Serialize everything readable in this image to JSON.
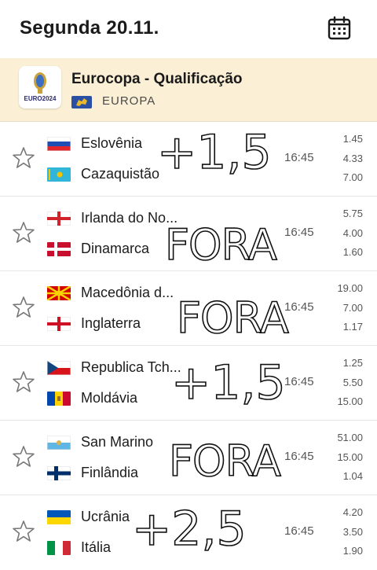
{
  "header": {
    "date": "Segunda 20.11."
  },
  "league": {
    "name": "Eurocopa - Qualificação",
    "region": "EUROPA",
    "logo_text": "EURO2024"
  },
  "matches": [
    {
      "home": "Eslovênia",
      "away": "Cazaquistão",
      "time": "16:45",
      "odds": [
        "1.45",
        "4.33",
        "7.00"
      ],
      "note": "+1,5"
    },
    {
      "home": "Irlanda do No...",
      "away": "Dinamarca",
      "time": "16:45",
      "odds": [
        "5.75",
        "4.00",
        "1.60"
      ],
      "note": "FORA"
    },
    {
      "home": "Macedônia d...",
      "away": "Inglaterra",
      "time": "16:45",
      "odds": [
        "19.00",
        "7.00",
        "1.17"
      ],
      "note": "FORA"
    },
    {
      "home": "Republica Tch...",
      "away": "Moldávia",
      "time": "16:45",
      "odds": [
        "1.25",
        "5.50",
        "15.00"
      ],
      "note": "+1,5"
    },
    {
      "home": "San Marino",
      "away": "Finlândia",
      "time": "16:45",
      "odds": [
        "51.00",
        "15.00",
        "1.04"
      ],
      "note": "FORA"
    },
    {
      "home": "Ucrânia",
      "away": "Itália",
      "time": "16:45",
      "odds": [
        "4.20",
        "3.50",
        "1.90"
      ],
      "note": "+2,5"
    }
  ],
  "icons": {
    "calendar": "calendar-icon",
    "star": "star-icon"
  }
}
